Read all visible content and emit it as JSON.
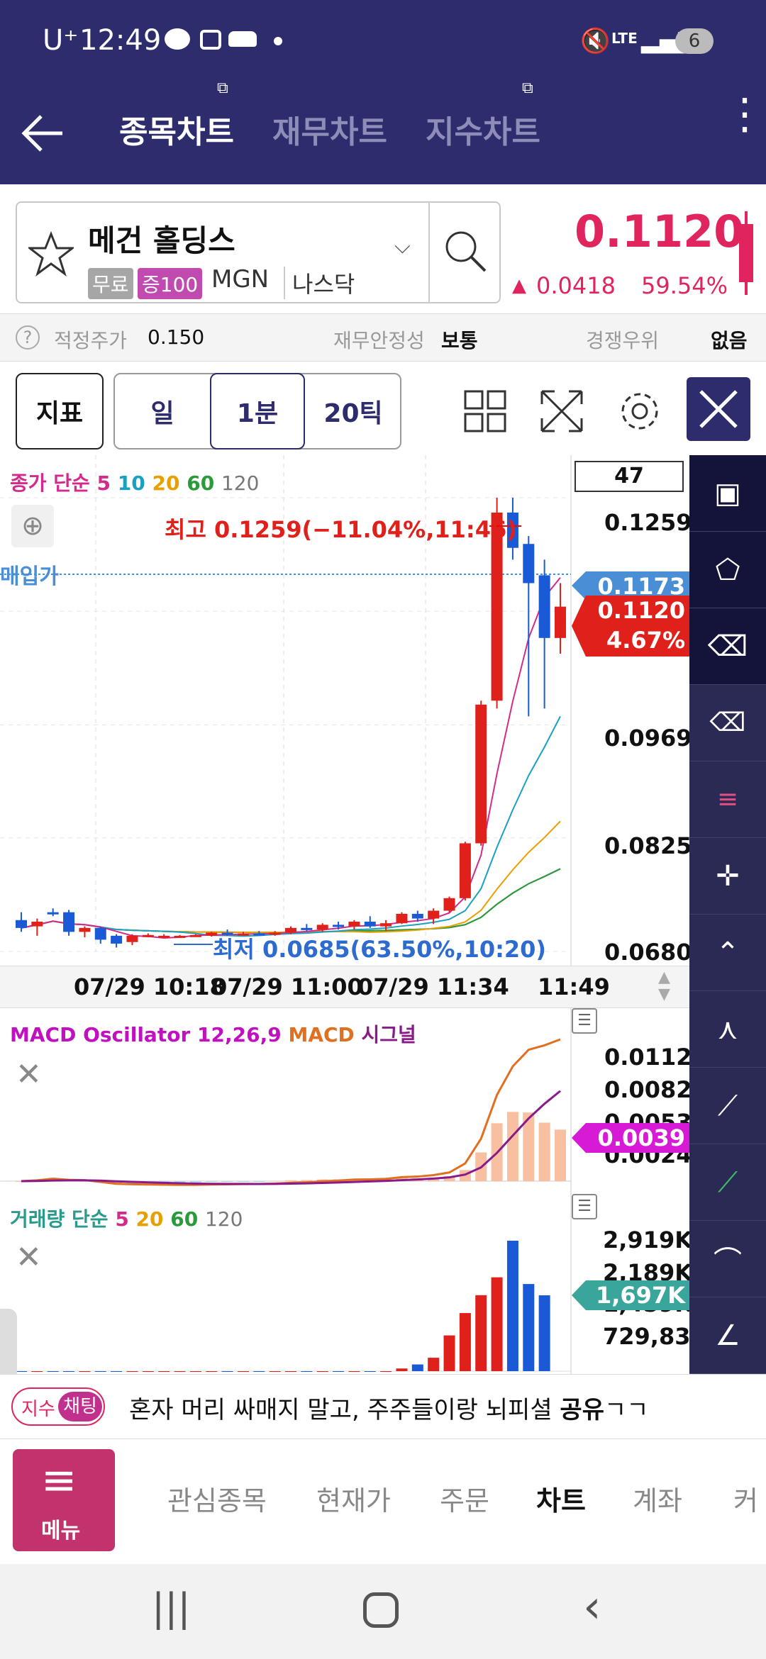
{
  "status": {
    "carrier": "U⁺",
    "time": "12:49",
    "net": "LTE",
    "battery": "6"
  },
  "appbar": {
    "tabs": [
      "종목차트",
      "재무차트",
      "지수차트"
    ]
  },
  "stock": {
    "name": "메건 홀딩스",
    "badge1": "무료",
    "badge2": "증100",
    "ticker": "MGN",
    "market": "나스닥",
    "price": "0.1120",
    "change": "0.0418",
    "pct": "59.54%"
  },
  "fair": {
    "label": "적정주가",
    "value": "0.150",
    "stab_label": "재무안정성",
    "stab_value": "보통",
    "comp_label": "경쟁우위",
    "comp_value": "없음"
  },
  "toolbar": {
    "indicator": "지표",
    "day": "일",
    "min1": "1분",
    "tick20": "20틱"
  },
  "main": {
    "legend_prefix": "종가 단순",
    "ma5": "5",
    "ma10": "10",
    "ma20": "20",
    "ma60": "60",
    "ma120": "120",
    "count": "47",
    "high_note": "최고 0.1259(−11.04%,11:46)",
    "low_note": "최저 0.0685(63.50%,10:20)",
    "avg_label": "매입가",
    "ticks": [
      "0.1259",
      "0.0969",
      "0.0825",
      "0.0680"
    ],
    "tag_avg": "0.1173",
    "tag_price": "0.1120",
    "tag_pct": "4.67%",
    "times": [
      "07/29 10:18",
      "07/29 11:00",
      "07/29 11:34",
      "11:49"
    ]
  },
  "macd": {
    "name": "MACD Oscillator 12,26,9",
    "macd": "MACD",
    "signal": "시그널",
    "ticks": [
      "0.0112",
      "0.0082",
      "0.0053",
      "0.0024"
    ],
    "tag": "0.0039"
  },
  "volume": {
    "name": "거래량 단순",
    "ma5": "5",
    "ma20": "20",
    "ma60": "60",
    "ma120": "120",
    "ticks": [
      "2,919K",
      "2,189K",
      "1,459K",
      "729,835"
    ],
    "tag": "1,697K"
  },
  "chat": {
    "badge1": "지수",
    "badge2": "채팅",
    "text": "혼자 머리 싸매지 말고, 주주들이랑 뇌피셜 ",
    "bold": "공유",
    "tail": "ㄱㄱ"
  },
  "nav": {
    "menu": "메뉴",
    "items": [
      "관심종목",
      "현재가",
      "주문",
      "차트",
      "계좌",
      "커"
    ]
  },
  "chart_data": {
    "type": "candlestick",
    "candles": [
      {
        "o": 0.072,
        "h": 0.073,
        "l": 0.0705,
        "c": 0.071
      },
      {
        "o": 0.0712,
        "h": 0.0722,
        "l": 0.07,
        "c": 0.0718
      },
      {
        "o": 0.073,
        "h": 0.0735,
        "l": 0.0725,
        "c": 0.0728
      },
      {
        "o": 0.073,
        "h": 0.0733,
        "l": 0.07,
        "c": 0.0705
      },
      {
        "o": 0.0705,
        "h": 0.0712,
        "l": 0.0698,
        "c": 0.071
      },
      {
        "o": 0.071,
        "h": 0.0712,
        "l": 0.069,
        "c": 0.0695
      },
      {
        "o": 0.07,
        "h": 0.0702,
        "l": 0.0685,
        "c": 0.069
      },
      {
        "o": 0.0692,
        "h": 0.0702,
        "l": 0.0688,
        "c": 0.07
      },
      {
        "o": 0.07,
        "h": 0.0703,
        "l": 0.0698,
        "c": 0.0701
      },
      {
        "o": 0.07,
        "h": 0.0702,
        "l": 0.0699,
        "c": 0.07
      },
      {
        "o": 0.07,
        "h": 0.0701,
        "l": 0.0699,
        "c": 0.07
      },
      {
        "o": 0.07,
        "h": 0.0702,
        "l": 0.0699,
        "c": 0.0701
      },
      {
        "o": 0.07,
        "h": 0.0705,
        "l": 0.0699,
        "c": 0.0704
      },
      {
        "o": 0.0704,
        "h": 0.0708,
        "l": 0.07,
        "c": 0.0702
      },
      {
        "o": 0.0702,
        "h": 0.0705,
        "l": 0.07,
        "c": 0.0703
      },
      {
        "o": 0.0703,
        "h": 0.0706,
        "l": 0.0701,
        "c": 0.0702
      },
      {
        "o": 0.0702,
        "h": 0.0706,
        "l": 0.07,
        "c": 0.0704
      },
      {
        "o": 0.0704,
        "h": 0.0712,
        "l": 0.0702,
        "c": 0.071
      },
      {
        "o": 0.071,
        "h": 0.0715,
        "l": 0.0706,
        "c": 0.0708
      },
      {
        "o": 0.0708,
        "h": 0.0716,
        "l": 0.0705,
        "c": 0.0714
      },
      {
        "o": 0.0714,
        "h": 0.0718,
        "l": 0.0708,
        "c": 0.0712
      },
      {
        "o": 0.0712,
        "h": 0.072,
        "l": 0.0708,
        "c": 0.0718
      },
      {
        "o": 0.0718,
        "h": 0.0725,
        "l": 0.071,
        "c": 0.0712
      },
      {
        "o": 0.0712,
        "h": 0.072,
        "l": 0.0706,
        "c": 0.0716
      },
      {
        "o": 0.0716,
        "h": 0.073,
        "l": 0.0715,
        "c": 0.0728
      },
      {
        "o": 0.0728,
        "h": 0.0732,
        "l": 0.0718,
        "c": 0.0722
      },
      {
        "o": 0.0722,
        "h": 0.0735,
        "l": 0.0715,
        "c": 0.0732
      },
      {
        "o": 0.0732,
        "h": 0.075,
        "l": 0.073,
        "c": 0.0748
      },
      {
        "o": 0.0748,
        "h": 0.082,
        "l": 0.0745,
        "c": 0.0818
      },
      {
        "o": 0.0818,
        "h": 0.1,
        "l": 0.0815,
        "c": 0.0995
      },
      {
        "o": 0.1,
        "h": 0.1259,
        "l": 0.099,
        "c": 0.124
      },
      {
        "o": 0.124,
        "h": 0.1259,
        "l": 0.118,
        "c": 0.1195
      },
      {
        "o": 0.12,
        "h": 0.121,
        "l": 0.098,
        "c": 0.115
      },
      {
        "o": 0.116,
        "h": 0.118,
        "l": 0.099,
        "c": 0.108
      },
      {
        "o": 0.108,
        "h": 0.115,
        "l": 0.106,
        "c": 0.112
      }
    ],
    "ylim": [
      0.068,
      0.1259
    ],
    "volume": [
      0,
      0,
      0,
      0,
      0,
      0,
      0,
      0,
      0,
      0,
      0,
      0,
      0,
      0,
      0,
      0,
      0,
      0,
      0,
      0,
      0,
      0,
      0,
      0,
      60,
      150,
      300,
      800,
      1300,
      1700,
      2100,
      2919,
      1950,
      1697
    ],
    "volume_max": 2919
  }
}
